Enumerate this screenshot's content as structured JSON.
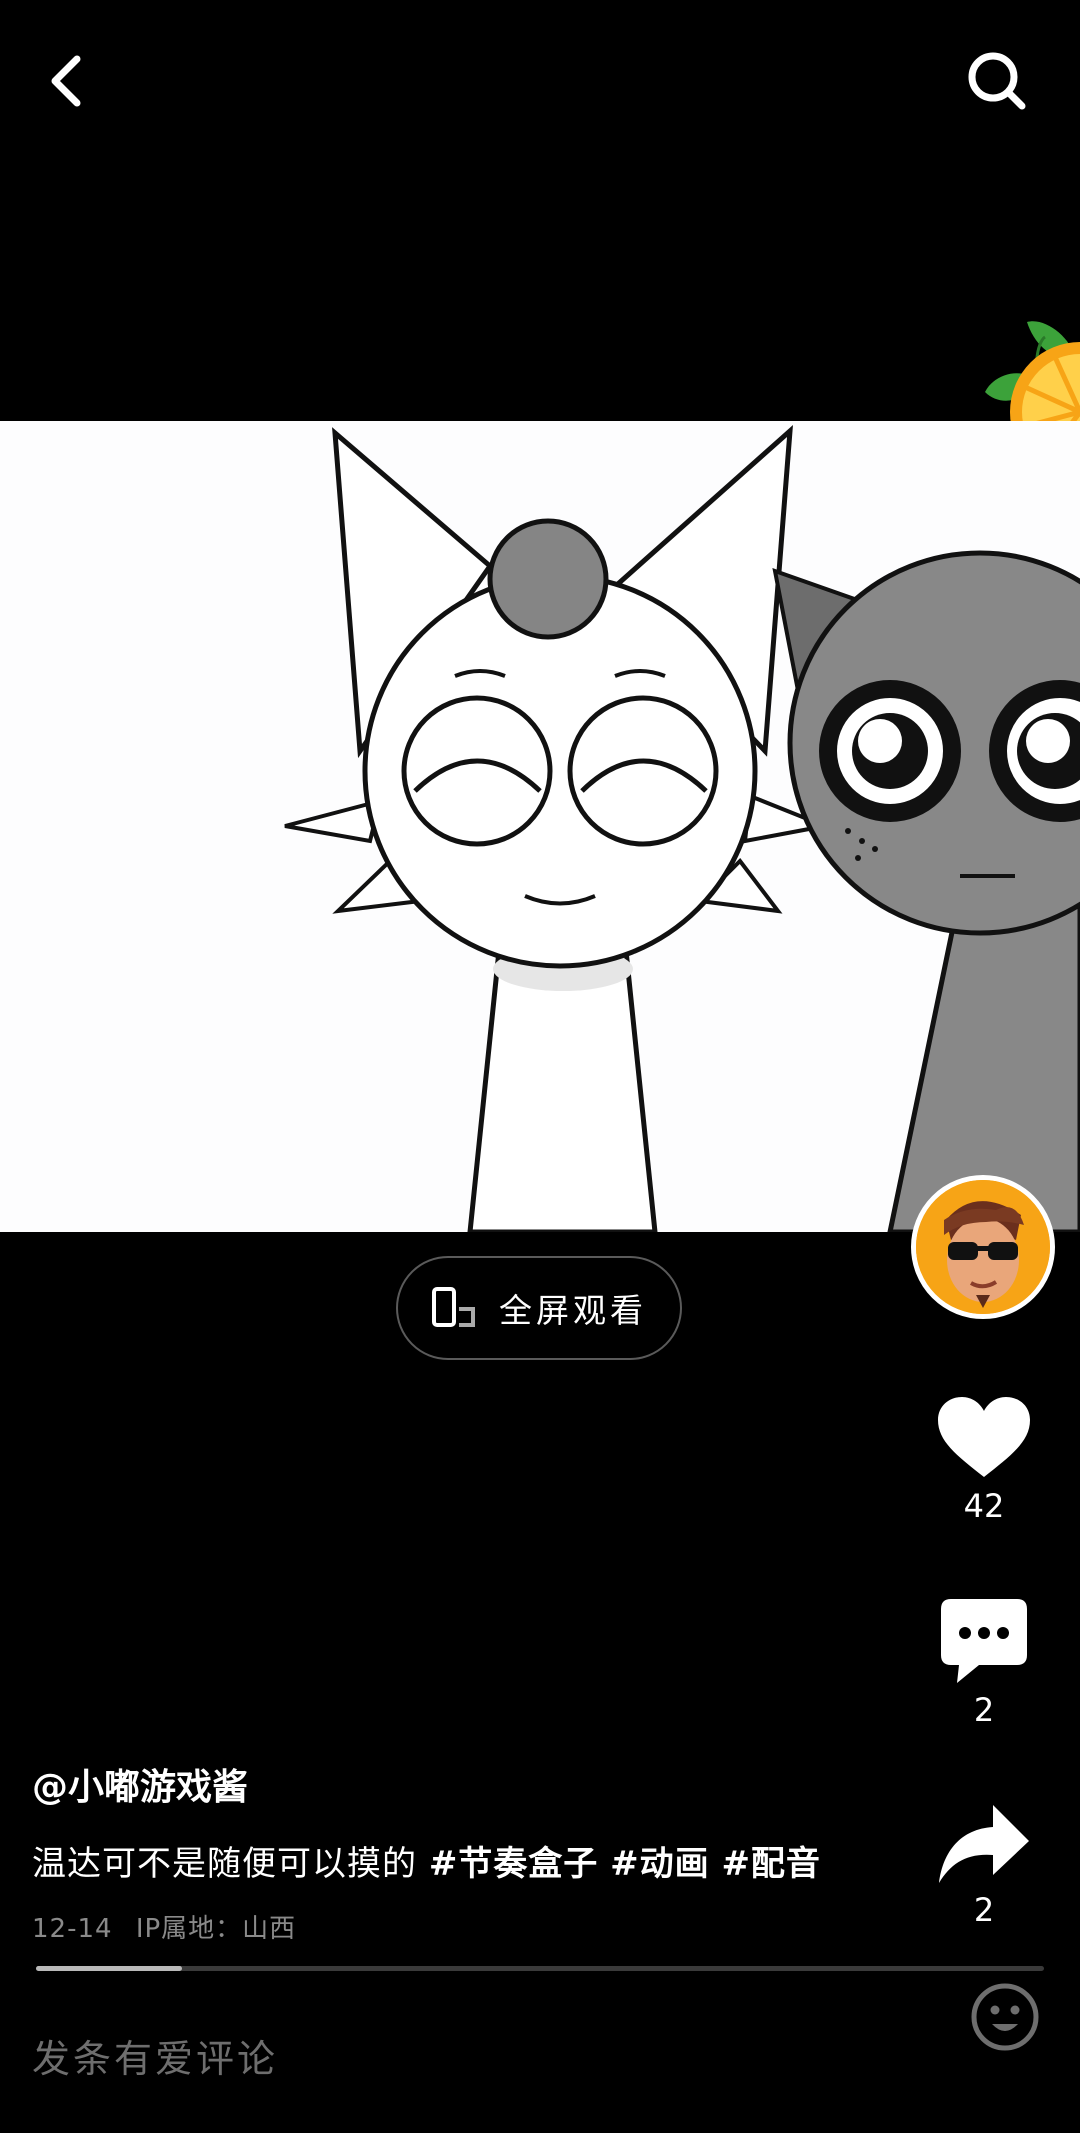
{
  "header": {
    "back_icon": "chevron-left-icon",
    "search_icon": "search-icon"
  },
  "video": {
    "fullscreen_label": "全屏观看",
    "fullscreen_icon": "rotate-phone-icon"
  },
  "actions": {
    "like_count": "42",
    "comment_count": "2",
    "share_count": "2",
    "like_icon": "heart-icon",
    "comment_icon": "comment-bubble-icon",
    "share_icon": "share-arrow-icon"
  },
  "post": {
    "author": "@小嘟游戏酱",
    "caption_text": "温达可不是随便可以摸的",
    "tags": [
      "#节奏盒子",
      "#动画",
      "#配音"
    ],
    "date": "12-14",
    "ip_location": "IP属地：山西"
  },
  "playback": {
    "progress_fraction": 0.145
  },
  "comment_bar": {
    "placeholder": "发条有爱评论",
    "emoji_icon": "emoji-smile-icon"
  },
  "colors": {
    "background": "#000000",
    "heart": "#ffffff",
    "orange_badge": "#f7a416"
  }
}
